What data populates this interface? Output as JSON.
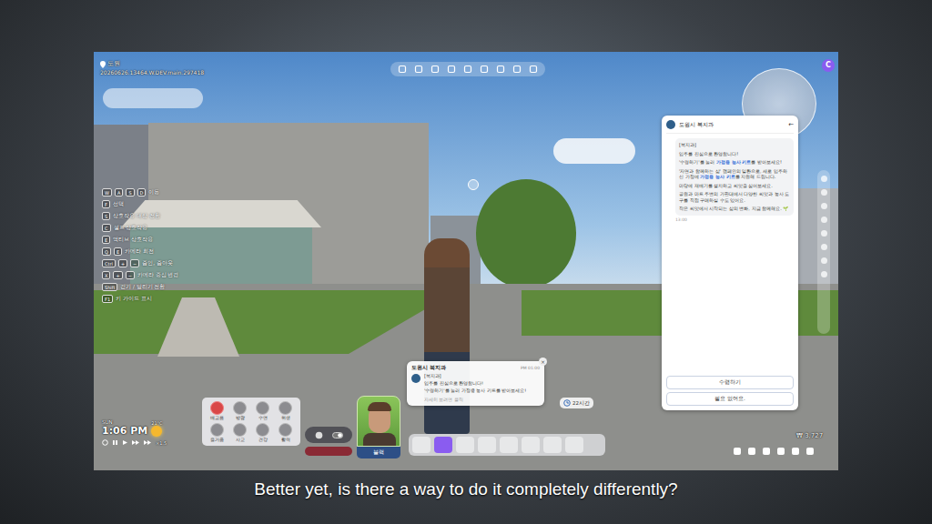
{
  "hud": {
    "location": "도원",
    "build": "20260626.13464.W.DEV.main.297418",
    "profile_badge": "C",
    "key_guide": [
      {
        "keys": [
          "W",
          "A",
          "S",
          "D"
        ],
        "label": "이동"
      },
      {
        "keys": [
          "F"
        ],
        "label": "선택"
      },
      {
        "keys": [
          "S"
        ],
        "label": "상호작용 대상 전환"
      },
      {
        "keys": [
          "C"
        ],
        "label": "셀프 상호작용"
      },
      {
        "keys": [
          "E"
        ],
        "label": "액티브 상호작용"
      },
      {
        "keys": [
          "Q",
          "E"
        ],
        "label": "카메라 회전"
      },
      {
        "keys": [
          "Ctrl",
          "+",
          "−"
        ],
        "label": "줌인, 줌아웃"
      },
      {
        "keys": [
          "X",
          "+",
          "−"
        ],
        "label": "카메라 중심 변경"
      },
      {
        "keys": [
          "Shift"
        ],
        "label": "걷기 / 달리기 전환"
      },
      {
        "keys": [
          "F1"
        ],
        "label": "키 가이드 표시"
      }
    ],
    "clock": {
      "day": "SUN",
      "time": "1:06 PM",
      "temperature": "21°C",
      "speed": "×1.5"
    },
    "needs": [
      {
        "label": "배고픔",
        "selected": true
      },
      {
        "label": "방광",
        "selected": false
      },
      {
        "label": "수면",
        "selected": false
      },
      {
        "label": "위생",
        "selected": false
      },
      {
        "label": "즐거움",
        "selected": false
      },
      {
        "label": "사교",
        "selected": false
      },
      {
        "label": "건강",
        "selected": false
      },
      {
        "label": "활력",
        "selected": false
      }
    ],
    "character": {
      "name": "블랙"
    },
    "timer": "22시간",
    "money": "₩ 3,727"
  },
  "notification": {
    "sender": "도원시 복지과",
    "time": "PM 01:00",
    "close": "×",
    "lines": [
      "[복지과]",
      "입주를 진심으로 환영합니다!",
      "'수령하기'를 눌러 가정용 농사 키트를 받아보세요!"
    ],
    "footer": "자세히 보려면 클릭"
  },
  "chat": {
    "title": "도원시 복지과",
    "back": "←",
    "time": "13:00",
    "paragraphs": [
      [
        {
          "text": "[복지과]",
          "highlight": false
        }
      ],
      [
        {
          "text": "입주를 진심으로 환영합니다!",
          "highlight": false
        }
      ],
      [
        {
          "text": "'수령하기'를 눌러 ",
          "highlight": false
        },
        {
          "text": "가정용 농사 키트",
          "highlight": true
        },
        {
          "text": "를 받아보세요!",
          "highlight": false
        }
      ],
      [
        {
          "text": "'자연과 함께하는 삶' 캠페인의 일환으로, 새로 입주하신 가정에 ",
          "highlight": false
        },
        {
          "text": "가정용 농사 키트",
          "highlight": true
        },
        {
          "text": "를 지원해 드립니다.",
          "highlight": false
        }
      ],
      [
        {
          "text": "마당에 재배기를 설치하고 씨앗을 심어보세요.",
          "highlight": false
        }
      ],
      [
        {
          "text": "공원과 마트 주변의 가판대에서 다양한 씨앗과 농사 도구를 직접 구매하실 수도 있어요.",
          "highlight": false
        }
      ],
      [
        {
          "text": "작은 씨앗에서 시작되는 삶의 변화, 지금 함께해요. 🌱",
          "highlight": false
        }
      ]
    ],
    "buttons": [
      "수령하기",
      "필요 없어요."
    ]
  },
  "video": {
    "subtitle": "Better yet, is there a way to do it completely differently?"
  }
}
